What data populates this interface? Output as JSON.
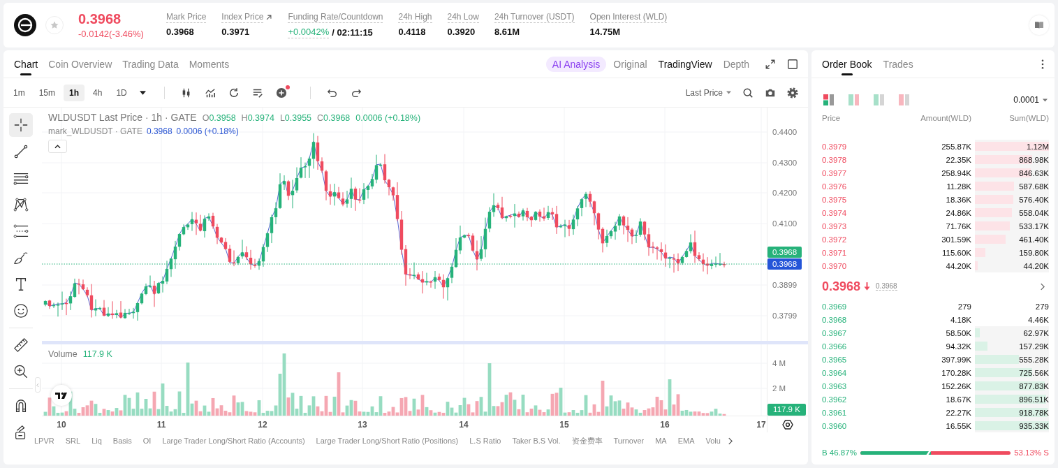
{
  "header": {
    "favorite": false,
    "price": "0.3968",
    "change": "-0.0142(-3.46%)",
    "stats": [
      {
        "kind": "plain",
        "label": "Mark Price",
        "value": "0.3968"
      },
      {
        "kind": "link",
        "label": "Index Price",
        "value": "0.3971"
      },
      {
        "kind": "funding",
        "label": "Funding Rate/Countdown",
        "value": "+0.0042%",
        "countdown": "/ 02:11:15"
      },
      {
        "kind": "plain",
        "label": "24h High",
        "value": "0.4118"
      },
      {
        "kind": "plain",
        "label": "24h Low",
        "value": "0.3920"
      },
      {
        "kind": "plain",
        "label": "24h Turnover (USDT)",
        "value": "8.61M"
      },
      {
        "kind": "plain",
        "label": "Open Interest (WLD)",
        "value": "14.75M"
      }
    ]
  },
  "chart_panel": {
    "tabs": [
      {
        "label": "Chart",
        "selected": true
      },
      {
        "label": "Coin Overview",
        "selected": false
      },
      {
        "label": "Trading Data",
        "selected": false
      },
      {
        "label": "Moments",
        "selected": false
      }
    ],
    "views": [
      {
        "kind": "ai",
        "label": "AI Analysis",
        "selected": false
      },
      {
        "kind": "text",
        "label": "Original",
        "selected": false
      },
      {
        "kind": "text",
        "label": "TradingView",
        "selected": true
      },
      {
        "kind": "text",
        "label": "Depth",
        "selected": false
      }
    ],
    "intervals": [
      {
        "label": "1m",
        "selected": false
      },
      {
        "label": "15m",
        "selected": false
      },
      {
        "label": "1h",
        "selected": true
      },
      {
        "label": "4h",
        "selected": false
      },
      {
        "label": "1D",
        "selected": false
      }
    ],
    "price_source": "Last Price",
    "tool_groups": [
      {
        "tools": [
          {
            "kind": "crosshair",
            "selected": true
          },
          {
            "kind": "trend-line",
            "selected": false
          },
          {
            "kind": "horizontal-lines",
            "selected": false
          },
          {
            "kind": "pattern",
            "selected": false
          },
          {
            "kind": "fib",
            "selected": false
          },
          {
            "kind": "brush",
            "selected": false
          },
          {
            "kind": "text",
            "selected": false
          },
          {
            "kind": "emoji",
            "selected": false
          }
        ]
      },
      {
        "tools": [
          {
            "kind": "ruler",
            "selected": false
          },
          {
            "kind": "zoom",
            "selected": false
          }
        ]
      },
      {
        "tools": [
          {
            "kind": "magnet",
            "selected": false
          },
          {
            "kind": "lock",
            "selected": false
          }
        ]
      }
    ],
    "legend": {
      "title": "WLDUSDT Last Price · 1h · GATE",
      "ohlc": [
        {
          "key": "O",
          "value": "0.3958"
        },
        {
          "key": "H",
          "value": "0.3974"
        },
        {
          "key": "L",
          "value": "0.3955"
        },
        {
          "key": "C",
          "value": "0.3968"
        }
      ],
      "change": "0.0006 (+0.18%)",
      "mark_title": "mark_WLDUSDT · GATE",
      "mark_price": "0.3968",
      "mark_change": "0.0006 (+0.18%)"
    },
    "price_axis": [
      "0.4400",
      "0.4300",
      "0.4200",
      "0.4100",
      "0.3899",
      "0.3799"
    ],
    "price_badges": [
      {
        "text": "0.3968",
        "color": "#26b27a"
      },
      {
        "text": "0.3968",
        "color": "#2455d8"
      }
    ],
    "volume": {
      "label": "Volume",
      "value": "117.9 K",
      "axis": [
        "4 M",
        "2 M"
      ],
      "badge": "117.9 K"
    },
    "time_axis": [
      "10",
      "11",
      "12",
      "13",
      "14",
      "15",
      "16",
      "17"
    ],
    "indicators": [
      "LPVR",
      "SRL",
      "Liq",
      "Basis",
      "OI",
      "Large Trader Long/Short Ratio (Accounts)",
      "Large Trader Long/Short Ratio (Positions)",
      "L.S Ratio",
      "Taker B.S Vol.",
      "资金费率",
      "Turnover",
      "MA",
      "EMA",
      "Volu"
    ]
  },
  "order_book": {
    "tabs": [
      {
        "label": "Order Book",
        "selected": true
      },
      {
        "label": "Trades",
        "selected": false
      }
    ],
    "layouts": [
      {
        "kind": "both",
        "selected": true
      },
      {
        "kind": "split",
        "selected": false
      },
      {
        "kind": "bids",
        "selected": false
      },
      {
        "kind": "asks",
        "selected": false
      }
    ],
    "tick": "0.0001",
    "columns": [
      "Price",
      "Amount(WLD)",
      "Sum(WLD)"
    ],
    "asks": [
      {
        "price": "0.3979",
        "amount": "255.87K",
        "sum": "1.12M",
        "level": 1.0
      },
      {
        "price": "0.3978",
        "amount": "22.35K",
        "sum": "868.98K",
        "level": 0.776
      },
      {
        "price": "0.3977",
        "amount": "258.94K",
        "sum": "846.63K",
        "level": 0.756
      },
      {
        "price": "0.3976",
        "amount": "11.28K",
        "sum": "587.68K",
        "level": 0.525
      },
      {
        "price": "0.3975",
        "amount": "18.36K",
        "sum": "576.40K",
        "level": 0.515
      },
      {
        "price": "0.3974",
        "amount": "24.86K",
        "sum": "558.04K",
        "level": 0.498
      },
      {
        "price": "0.3973",
        "amount": "71.76K",
        "sum": "533.17K",
        "level": 0.476
      },
      {
        "price": "0.3972",
        "amount": "301.59K",
        "sum": "461.40K",
        "level": 0.412
      },
      {
        "price": "0.3971",
        "amount": "115.60K",
        "sum": "159.80K",
        "level": 0.143
      },
      {
        "price": "0.3970",
        "amount": "44.20K",
        "sum": "44.20K",
        "level": 0.039
      }
    ],
    "last_price": "0.3968",
    "mark_price": "0.3968",
    "bids": [
      {
        "price": "0.3969",
        "amount": "279",
        "sum": "279"
      },
      {
        "price": "0.3968",
        "amount": "4.18K",
        "sum": "4.46K"
      },
      {
        "price": "0.3967",
        "amount": "58.50K",
        "sum": "62.97K",
        "level": 0.067
      },
      {
        "price": "0.3966",
        "amount": "94.32K",
        "sum": "157.29K",
        "level": 0.168
      },
      {
        "price": "0.3965",
        "amount": "397.99K",
        "sum": "555.28K",
        "level": 0.594
      },
      {
        "price": "0.3964",
        "amount": "170.28K",
        "sum": "725.56K",
        "level": 0.776
      },
      {
        "price": "0.3963",
        "amount": "152.26K",
        "sum": "877.83K",
        "level": 0.939
      },
      {
        "price": "0.3962",
        "amount": "18.67K",
        "sum": "896.51K",
        "level": 0.958
      },
      {
        "price": "0.3961",
        "amount": "22.27K",
        "sum": "918.78K",
        "level": 0.982
      },
      {
        "price": "0.3960",
        "amount": "16.55K",
        "sum": "935.33K",
        "level": 1.0
      }
    ],
    "ratio": {
      "buy": "B 46.87%",
      "sell": "53.13% S",
      "level": 0.4687
    }
  }
}
